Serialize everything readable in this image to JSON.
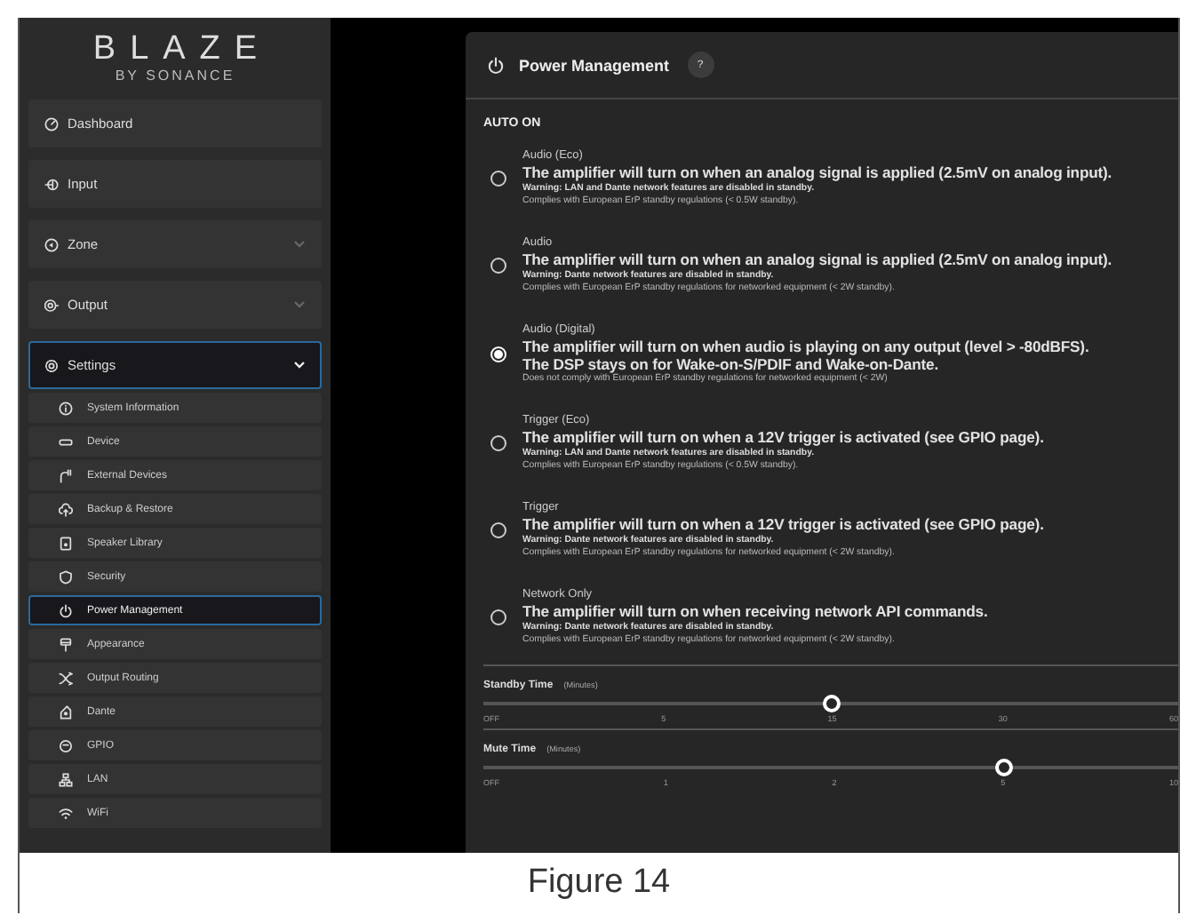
{
  "sidebar": {
    "logo": {
      "title": "BLAZE",
      "subtitle": "BY SONANCE"
    },
    "items": [
      {
        "label": "Dashboard",
        "kind": "link",
        "selected": false
      },
      {
        "label": "Input",
        "kind": "link",
        "selected": false
      },
      {
        "label": "Zone",
        "kind": "group",
        "selected": false
      },
      {
        "label": "Output",
        "kind": "group",
        "selected": false
      },
      {
        "label": "Settings",
        "kind": "group",
        "selected": true,
        "children": [
          {
            "label": "System Information",
            "selected": false
          },
          {
            "label": "Device",
            "selected": false
          },
          {
            "label": "External Devices",
            "selected": false
          },
          {
            "label": "Backup & Restore",
            "selected": false
          },
          {
            "label": "Speaker Library",
            "selected": false
          },
          {
            "label": "Security",
            "selected": false
          },
          {
            "label": "Power Management",
            "selected": true
          },
          {
            "label": "Appearance",
            "selected": false
          },
          {
            "label": "Output Routing",
            "selected": false
          },
          {
            "label": "Dante",
            "selected": false
          },
          {
            "label": "GPIO",
            "selected": false
          },
          {
            "label": "LAN",
            "selected": false
          },
          {
            "label": "WiFi",
            "selected": false
          }
        ]
      }
    ]
  },
  "panel": {
    "title": "Power Management",
    "help": "?",
    "section": "AUTO ON",
    "options": [
      {
        "name": "Audio (Eco)",
        "description": [
          "The amplifier will turn on when an analog signal is applied (2.5mV on analog input)."
        ],
        "warning": "Warning: LAN and Dante network features are disabled in standby.",
        "note": "Complies with European ErP standby regulations (< 0.5W standby).",
        "selected": false
      },
      {
        "name": "Audio",
        "description": [
          "The amplifier will turn on when an analog signal is applied (2.5mV on analog input)."
        ],
        "warning": "Warning: Dante network features are disabled in standby.",
        "note": "Complies with European ErP standby regulations for networked equipment (< 2W standby).",
        "selected": false
      },
      {
        "name": "Audio (Digital)",
        "description": [
          "The amplifier will turn on when audio is playing on any output (level > -80dBFS).",
          "The DSP stays on for Wake-on-S/PDIF and Wake-on-Dante."
        ],
        "note": "Does not comply with European ErP standby regulations for networked equipment (< 2W)",
        "selected": true
      },
      {
        "name": "Trigger (Eco)",
        "description": [
          "The amplifier will turn on when a 12V trigger is activated (see GPIO page)."
        ],
        "warning": "Warning: LAN and Dante network features are disabled in standby.",
        "note": "Complies with European ErP standby regulations (< 0.5W standby).",
        "selected": false
      },
      {
        "name": "Trigger",
        "description": [
          "The amplifier will turn on when a 12V trigger is activated (see GPIO page)."
        ],
        "warning": "Warning: Dante network features are disabled in standby.",
        "note": "Complies with European ErP standby regulations for networked equipment (< 2W standby).",
        "selected": false
      },
      {
        "name": "Network Only",
        "description": [
          "The amplifier will turn on when receiving network API commands."
        ],
        "warning": "Warning: Dante network features are disabled in standby.",
        "note": "Complies with European ErP standby regulations for networked equipment (< 2W standby).",
        "selected": false
      }
    ],
    "sliders": [
      {
        "label": "Standby Time",
        "unit": "(Minutes)",
        "level": 0.5,
        "ticks": [
          "OFF",
          "5",
          "15",
          "30",
          "60"
        ]
      },
      {
        "label": "Mute Time",
        "unit": "(Minutes)",
        "level": 0.75,
        "ticks": [
          "OFF",
          "1",
          "2",
          "5",
          "10"
        ]
      }
    ]
  },
  "caption": "Figure 14"
}
